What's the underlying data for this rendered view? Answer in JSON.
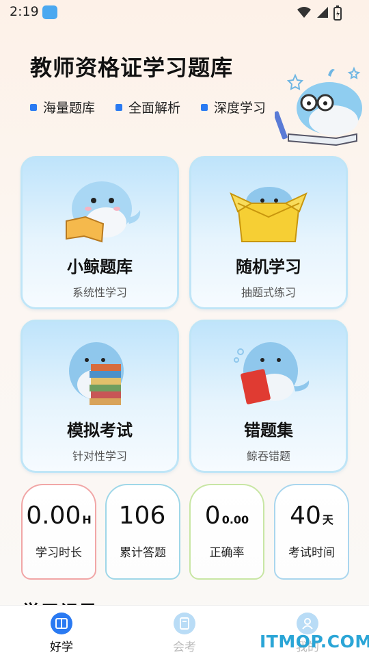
{
  "status": {
    "time": "2:19"
  },
  "header": {
    "title": "教师资格证学习题库",
    "tags": [
      "海量题库",
      "全面解析",
      "深度学习"
    ]
  },
  "cards": [
    {
      "title": "小鲸题库",
      "subtitle": "系统性学习"
    },
    {
      "title": "随机学习",
      "subtitle": "抽题式练习"
    },
    {
      "title": "模拟考试",
      "subtitle": "针对性学习"
    },
    {
      "title": "错题集",
      "subtitle": "鲸吞错题"
    }
  ],
  "stats": [
    {
      "value": "0.00",
      "unit": "H",
      "label": "学习时长",
      "accent": "#f1a6a6"
    },
    {
      "value": "106",
      "unit": "",
      "label": "累计答题",
      "accent": "#9fd7e8"
    },
    {
      "value": "0",
      "unit": "0.00",
      "label": "正确率",
      "accent": "#c8e6a4"
    },
    {
      "value": "40",
      "unit": "天",
      "label": "考试时间",
      "accent": "#a9d6ee"
    }
  ],
  "section_peek": "学习记录",
  "tabbar": {
    "items": [
      {
        "label": "好学",
        "active": true
      },
      {
        "label": "会考",
        "active": false
      },
      {
        "label": "我的",
        "active": false
      }
    ]
  },
  "watermark": "ITMOP.COM",
  "colors": {
    "accent": "#2a7af2",
    "card_bg": "#cfeafb",
    "watermark": "#2aa5d6"
  }
}
